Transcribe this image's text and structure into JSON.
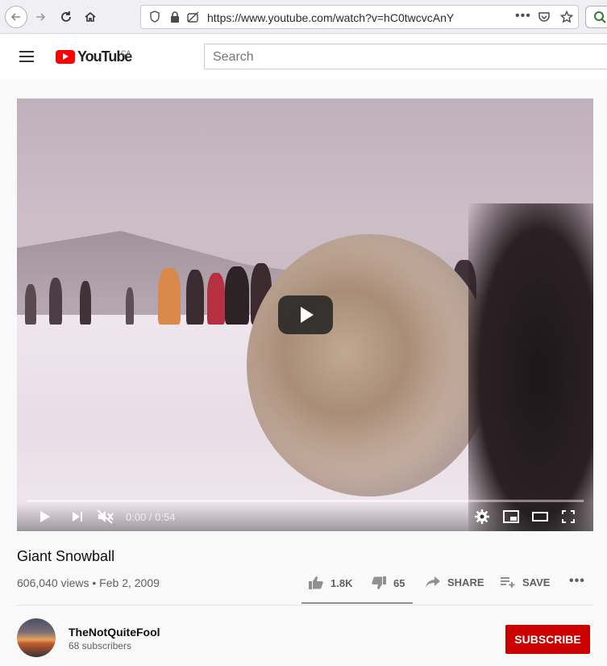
{
  "browser": {
    "url": "https://www.youtube.com/watch?v=hC0twcvcAnY",
    "icons": [
      "back-icon",
      "forward-icon",
      "reload-icon",
      "home-icon",
      "shield-icon",
      "lock-icon",
      "permissions-icon",
      "more-icon",
      "pocket-icon",
      "star-icon"
    ]
  },
  "header": {
    "logo_text": "YouTube",
    "region": "CA",
    "search_placeholder": "Search"
  },
  "player": {
    "time": "0:00 / 0:54",
    "progress": 0,
    "muted": true
  },
  "video": {
    "title": "Giant Snowball",
    "meta": "606,040 views • Feb 2, 2009",
    "likes": "1.8K",
    "dislikes": "65",
    "share_label": "SHARE",
    "save_label": "SAVE",
    "like_ratio": 0.965
  },
  "channel": {
    "name": "TheNotQuiteFool",
    "subscribers": "68 subscribers",
    "subscribe_label": "SUBSCRIBE"
  },
  "colors": {
    "brand_red": "#ff0000",
    "subscribe_red": "#cc0000"
  }
}
